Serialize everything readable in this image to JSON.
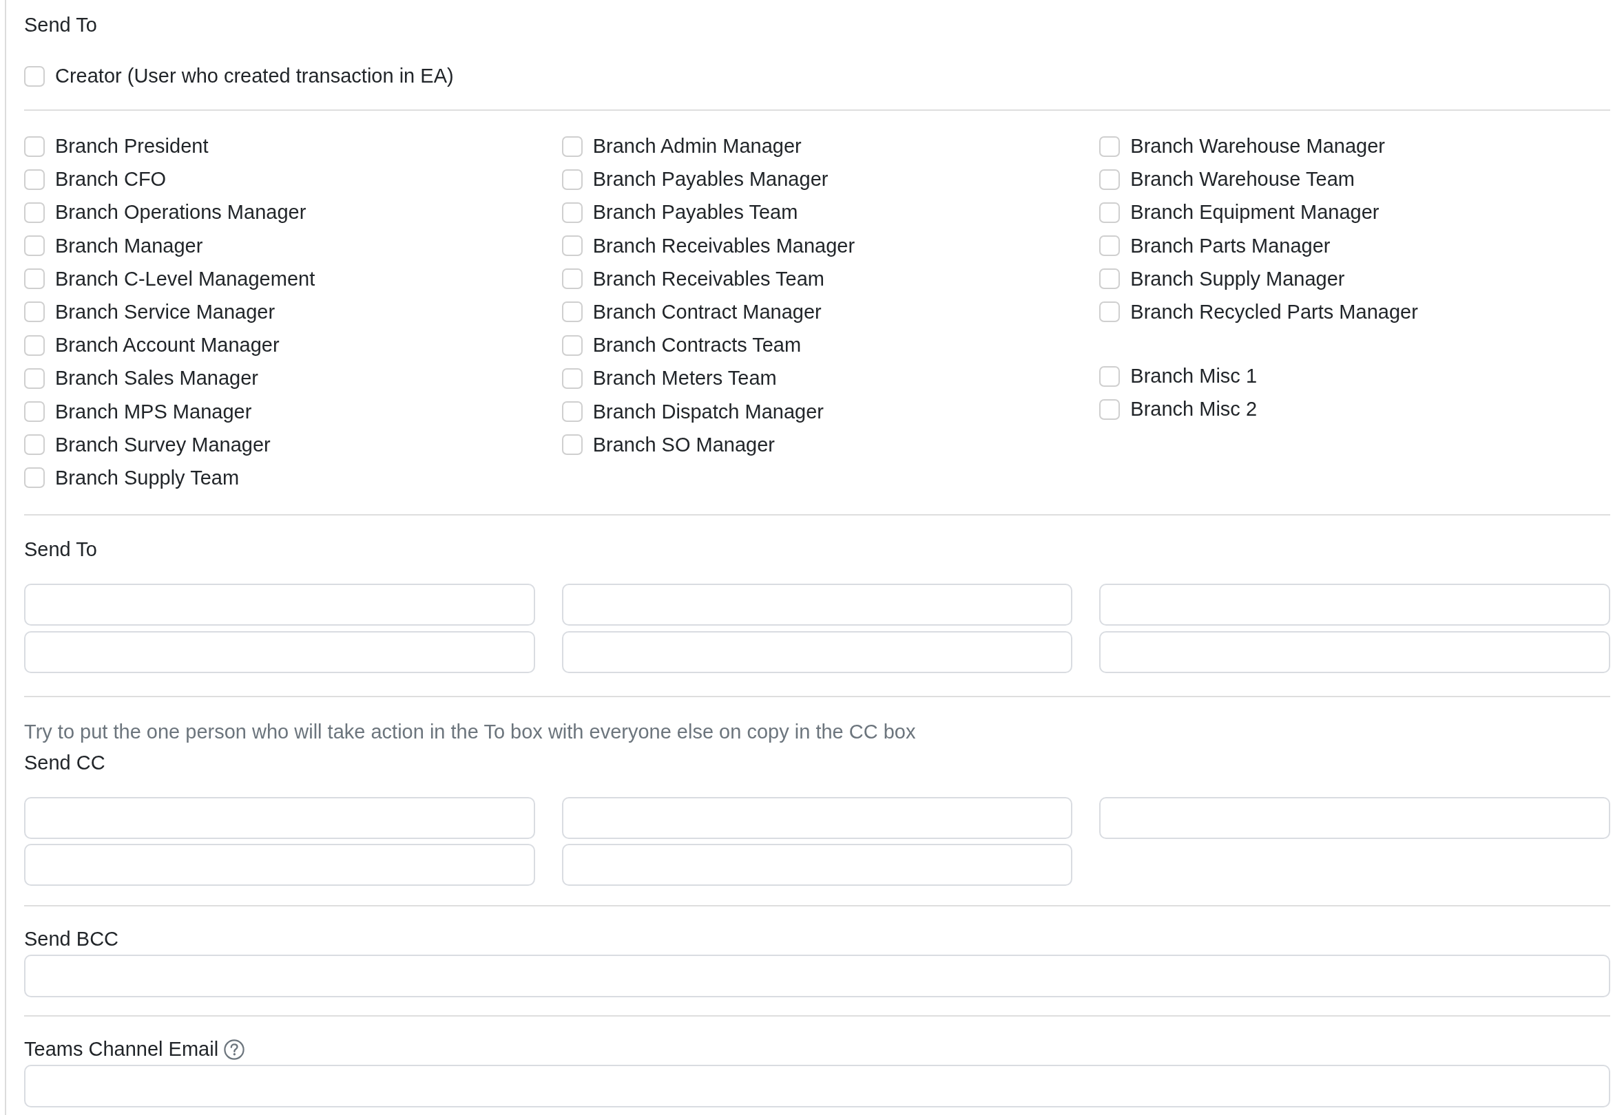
{
  "send_to_roles": {
    "label": "Send To",
    "creator": {
      "label": "Creator (User who created transaction in EA)",
      "checked": false
    },
    "columns": [
      {
        "groups": [
          {
            "items": [
              {
                "label": "Branch President",
                "checked": false
              },
              {
                "label": "Branch CFO",
                "checked": false
              },
              {
                "label": "Branch Operations Manager",
                "checked": false
              },
              {
                "label": "Branch Manager",
                "checked": false
              },
              {
                "label": "Branch C-Level Management",
                "checked": false
              },
              {
                "label": "Branch Service Manager",
                "checked": false
              },
              {
                "label": "Branch Account Manager",
                "checked": false
              },
              {
                "label": "Branch Sales Manager",
                "checked": false
              },
              {
                "label": "Branch MPS Manager",
                "checked": false
              },
              {
                "label": "Branch Survey Manager",
                "checked": false
              },
              {
                "label": "Branch Supply Team",
                "checked": false
              }
            ]
          }
        ]
      },
      {
        "groups": [
          {
            "items": [
              {
                "label": "Branch Admin Manager",
                "checked": false
              },
              {
                "label": "Branch Payables Manager",
                "checked": false
              },
              {
                "label": "Branch Payables Team",
                "checked": false
              },
              {
                "label": "Branch Receivables Manager",
                "checked": false
              },
              {
                "label": "Branch Receivables Team",
                "checked": false
              },
              {
                "label": "Branch Contract Manager",
                "checked": false
              },
              {
                "label": "Branch Contracts Team",
                "checked": false
              },
              {
                "label": "Branch Meters Team",
                "checked": false
              },
              {
                "label": "Branch Dispatch Manager",
                "checked": false
              },
              {
                "label": "Branch SO Manager",
                "checked": false
              }
            ]
          }
        ]
      },
      {
        "groups": [
          {
            "items": [
              {
                "label": "Branch Warehouse Manager",
                "checked": false
              },
              {
                "label": "Branch Warehouse Team",
                "checked": false
              },
              {
                "label": "Branch Equipment Manager",
                "checked": false
              },
              {
                "label": "Branch Parts Manager",
                "checked": false
              },
              {
                "label": "Branch Supply Manager",
                "checked": false
              },
              {
                "label": "Branch Recycled Parts Manager",
                "checked": false
              }
            ]
          },
          {
            "items": [
              {
                "label": "Branch Misc 1",
                "checked": false
              },
              {
                "label": "Branch Misc 2",
                "checked": false
              }
            ]
          }
        ]
      }
    ]
  },
  "send_to_fields": {
    "label": "Send To",
    "columns": [
      {
        "fields": [
          {
            "kind": "input"
          },
          {
            "kind": "input"
          }
        ]
      },
      {
        "fields": [
          {
            "kind": "input"
          },
          {
            "kind": "input"
          }
        ]
      },
      {
        "fields": [
          {
            "kind": "input"
          },
          {
            "kind": "input"
          }
        ]
      }
    ]
  },
  "send_cc": {
    "hint": "Try to put the one person who will take action in the To box with everyone else on copy in the CC box",
    "label": "Send CC",
    "columns": [
      {
        "fields": [
          {
            "kind": "input"
          },
          {
            "kind": "input"
          }
        ]
      },
      {
        "fields": [
          {
            "kind": "input"
          },
          {
            "kind": "input"
          }
        ]
      },
      {
        "fields": [
          {
            "kind": "input"
          }
        ]
      }
    ]
  },
  "send_bcc": {
    "label": "Send BCC",
    "field": {
      "kind": "input"
    }
  },
  "teams_channel_email": {
    "label": "Teams Channel Email",
    "help_icon": true,
    "field": {
      "kind": "input"
    }
  }
}
